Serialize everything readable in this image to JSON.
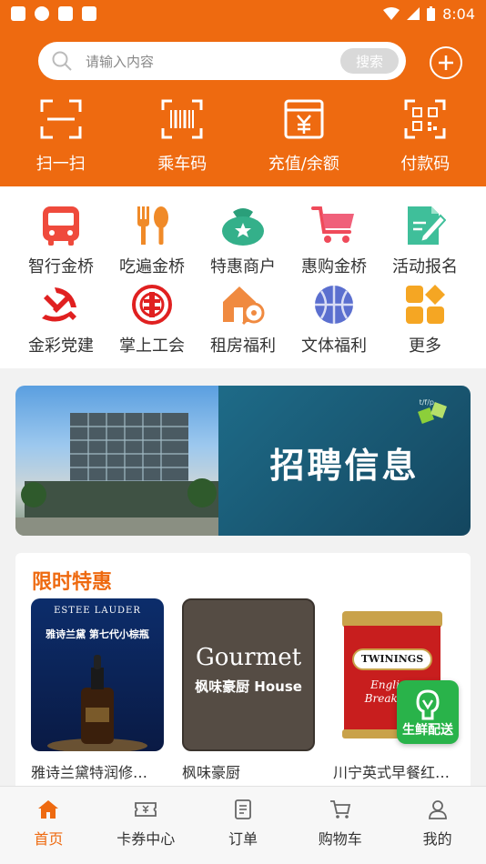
{
  "status_bar": {
    "time": "8:04"
  },
  "search": {
    "placeholder": "请输入内容",
    "button_label": "搜索"
  },
  "quick_actions": [
    {
      "label": "扫一扫",
      "icon": "scan-icon"
    },
    {
      "label": "乘车码",
      "icon": "barcode-icon"
    },
    {
      "label": "充值/余额",
      "icon": "yuan-wallet-icon"
    },
    {
      "label": "付款码",
      "icon": "qr-code-icon"
    }
  ],
  "services": [
    {
      "label": "智行金桥",
      "icon": "bus-icon"
    },
    {
      "label": "吃遍金桥",
      "icon": "fork-spoon-icon"
    },
    {
      "label": "特惠商户",
      "icon": "star-bag-icon"
    },
    {
      "label": "惠购金桥",
      "icon": "shopping-cart-icon"
    },
    {
      "label": "活动报名",
      "icon": "edit-document-icon"
    },
    {
      "label": "金彩党建",
      "icon": "party-emblem-icon"
    },
    {
      "label": "掌上工会",
      "icon": "union-emblem-icon"
    },
    {
      "label": "租房福利",
      "icon": "house-key-icon"
    },
    {
      "label": "文体福利",
      "icon": "basketball-icon"
    },
    {
      "label": "更多",
      "icon": "more-grid-icon"
    }
  ],
  "banner": {
    "title": "招聘信息",
    "corner_text": "t/f/p"
  },
  "deals": {
    "title": "限时特惠",
    "products": [
      {
        "name": "雅诗兰黛特润修…",
        "image_brand": "ESTEE LAUDER",
        "image_title": "雅诗兰黛 第七代小棕瓶"
      },
      {
        "name": "枫味豪厨",
        "image_brand": "Gourmet",
        "image_title": "枫味豪厨 House"
      },
      {
        "name": "川宁英式早餐红…",
        "image_brand": "TWININGS",
        "image_title": "English Breakfast"
      }
    ]
  },
  "floating_button": {
    "label": "生鲜配送"
  },
  "tabs": [
    {
      "label": "首页",
      "icon": "home-icon",
      "active": true
    },
    {
      "label": "卡券中心",
      "icon": "coupon-icon",
      "active": false
    },
    {
      "label": "订单",
      "icon": "order-icon",
      "active": false
    },
    {
      "label": "购物车",
      "icon": "cart-icon",
      "active": false
    },
    {
      "label": "我的",
      "icon": "user-icon",
      "active": false
    }
  ],
  "colors": {
    "brand": "#ee6a10",
    "fresh": "#29b34a"
  }
}
